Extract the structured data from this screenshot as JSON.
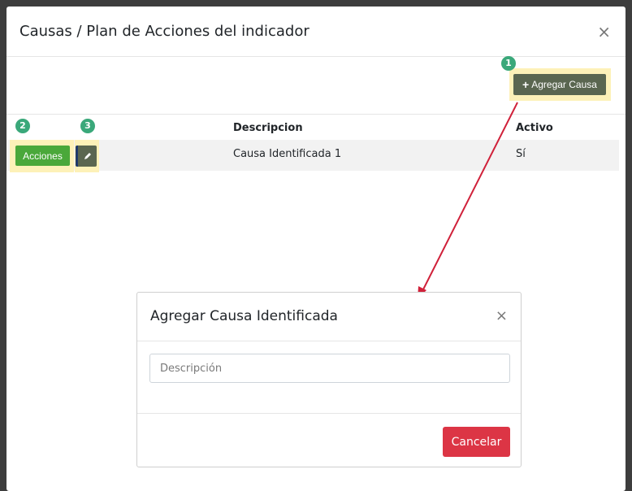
{
  "modal": {
    "title": "Causas / Plan de Acciones del indicador",
    "close_symbol": "×",
    "add_button": {
      "icon": "plus-icon",
      "label": "Agregar Causa"
    },
    "steps": [
      "1",
      "2",
      "3"
    ],
    "table": {
      "headers": [
        "",
        "Descripcion",
        "Activo"
      ],
      "rows": [
        {
          "actions_label": "Acciones",
          "edit_icon": "pencil-icon",
          "descripcion": "Causa Identificada 1",
          "activo": "Sí"
        }
      ]
    }
  },
  "inner_modal": {
    "title": "Agregar Causa Identificada",
    "close_symbol": "×",
    "input_placeholder": "Descripción",
    "input_value": "",
    "cancel_label": "Cancelar"
  },
  "colors": {
    "accent_green": "#3aa87a",
    "add_button": "#5a6650",
    "acciones_button": "#4aa83a",
    "cancel_button": "#dc3545",
    "arrow": "#d0213a",
    "highlight": "#fdf1b8"
  }
}
